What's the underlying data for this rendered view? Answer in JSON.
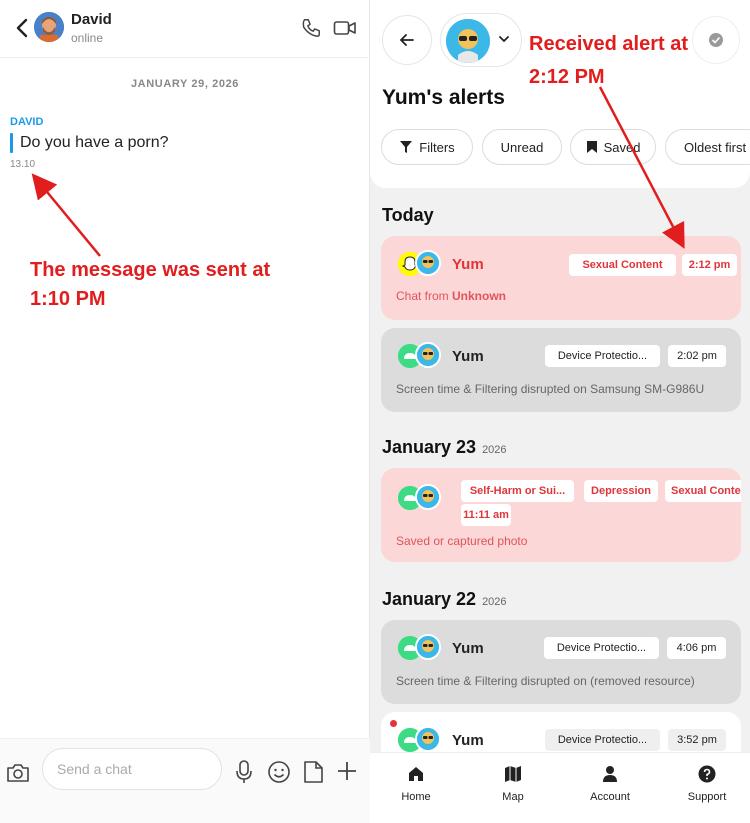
{
  "chat": {
    "contact_name": "David",
    "contact_status": "online",
    "date_separator": "JANUARY 29, 2026",
    "sender_label": "DAVID",
    "message_text": "Do you have a porn?",
    "message_time": "13.10",
    "input_placeholder": "Send a chat"
  },
  "annotations": {
    "left_line1": "The message was sent at",
    "left_line2": "1:10 PM",
    "right_line1": "Received alert at",
    "right_line2": "2:12 PM"
  },
  "alerts": {
    "title": "Yum's alerts",
    "filters": [
      "Filters",
      "Unread",
      "Saved",
      "Oldest first"
    ],
    "sections": [
      {
        "label": "Today",
        "year": ""
      },
      {
        "label": "January 23",
        "year": "2026"
      },
      {
        "label": "January 22",
        "year": "2026"
      }
    ],
    "cards": [
      {
        "name": "Yum",
        "tag": "Sexual Content",
        "time": "2:12 pm",
        "sub_prefix": "Chat from ",
        "sub_strong": "Unknown"
      },
      {
        "name": "Yum",
        "tag": "Device Protectio...",
        "time": "2:02 pm",
        "sub": "Screen time & Filtering disrupted on Samsung SM-G986U"
      },
      {
        "tags": [
          "Self-Harm or Sui...",
          "Depression",
          "Sexual Conte"
        ],
        "time": "11:11 am",
        "sub": "Saved or captured photo"
      },
      {
        "name": "Yum",
        "tag": "Device Protectio...",
        "time": "4:06 pm",
        "sub": "Screen time & Filtering disrupted on (removed resource)"
      },
      {
        "name": "Yum",
        "tag": "Device Protectio...",
        "time": "3:52 pm"
      }
    ]
  },
  "tabs": [
    "Home",
    "Map",
    "Account",
    "Support"
  ],
  "colors": {
    "accent_blue": "#1a9be9",
    "alert_red": "#e0343a",
    "annotation_red": "#e21d1d",
    "card_red_bg": "#fcd7d7",
    "card_grey_bg": "#dcdcdc"
  }
}
